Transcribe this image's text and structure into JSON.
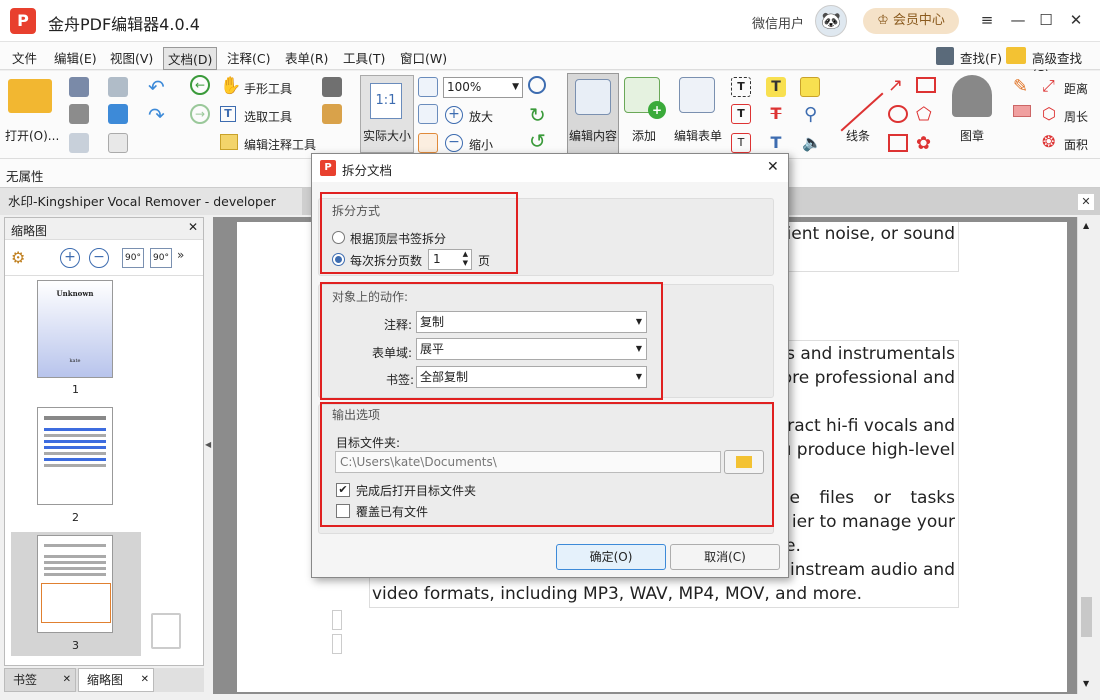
{
  "app": {
    "title": "金舟PDF编辑器4.0.4",
    "logo_letter": "P",
    "user": "微信用户",
    "member_button": "会员中心"
  },
  "window_controls": {
    "menu": "≡",
    "minimize": "—",
    "maximize": "☐",
    "close": "✕"
  },
  "menubar": [
    "文件",
    "编辑(E)",
    "视图(V)",
    "文档(D)",
    "注释(C)",
    "表单(R)",
    "工具(T)",
    "窗口(W)"
  ],
  "menubar_right": {
    "find": "查找(F)",
    "advanced_find": "高级查找(S)"
  },
  "toolbar": {
    "open": "打开(O)...",
    "hand": "手形工具",
    "select": "选取工具",
    "edit_annot": "编辑注释工具",
    "actual_size": "实际大小",
    "zoom_value": "100%",
    "zoom_in": "放大",
    "zoom_out": "缩小",
    "edit_content": "编辑内容",
    "add": "添加",
    "edit_form": "编辑表单",
    "lines": "线条",
    "stamp": "图章",
    "distance": "距离",
    "perimeter": "周长",
    "area": "面积"
  },
  "props_bar": "无属性",
  "doc_tab": "水印-Kingshiper Vocal Remover - developer info...",
  "left_panel": {
    "title": "缩略图",
    "pages": [
      "1",
      "2",
      "3"
    ],
    "thumb1_title": "Unknown",
    "thumb1_author": "kate"
  },
  "bottom_tabs": [
    "书签",
    "缩略图"
  ],
  "document": {
    "lines": [
      "ient noise, or sound",
      "s and instrumentals",
      "ore professional and",
      "ract hi-fi vocals and",
      "u produce high-level",
      "e files or tasks",
      "ier to manage your",
      "e.",
      "ainstream audio and",
      "video formats, including MP3, WAV, MP4, MOV, and more."
    ]
  },
  "dialog": {
    "title": "拆分文档",
    "close": "✕",
    "split_group": {
      "title": "拆分方式",
      "option_bookmark": "根据顶层书签拆分",
      "option_pages": "每次拆分页数",
      "pages_value": "1",
      "pages_unit": "页"
    },
    "action_group": {
      "title": "对象上的动作:",
      "annotation_label": "注释:",
      "annotation_value": "复制",
      "form_label": "表单域:",
      "form_value": "展平",
      "bookmark_label": "书签:",
      "bookmark_value": "全部复制"
    },
    "output_group": {
      "title": "输出选项",
      "folder_label": "目标文件夹:",
      "folder_value": "C:\\Users\\kate\\Documents\\",
      "open_after": "完成后打开目标文件夹",
      "overwrite": "覆盖已有文件"
    },
    "ok": "确定(O)",
    "cancel": "取消(C)"
  },
  "colors": {
    "accent_red": "#e02020",
    "logo": "#e8402e",
    "member_bg": "#f5e2c8"
  }
}
